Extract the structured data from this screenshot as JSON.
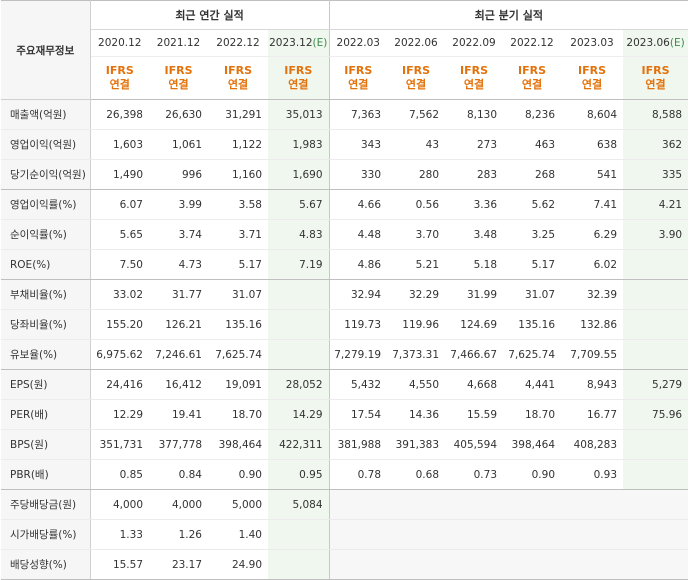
{
  "header": {
    "corner_label": "주요재무정보",
    "annual_title": "최근 연간 실적",
    "quarter_title": "최근 분기 실적",
    "ifrs_line1": "IFRS",
    "ifrs_line2": "연결"
  },
  "periods": [
    {
      "label": "2020.12",
      "estimate": ""
    },
    {
      "label": "2021.12",
      "estimate": ""
    },
    {
      "label": "2022.12",
      "estimate": ""
    },
    {
      "label": "2023.12",
      "estimate": "(E)"
    },
    {
      "label": "2022.03",
      "estimate": ""
    },
    {
      "label": "2022.06",
      "estimate": ""
    },
    {
      "label": "2022.09",
      "estimate": ""
    },
    {
      "label": "2022.12",
      "estimate": ""
    },
    {
      "label": "2023.03",
      "estimate": ""
    },
    {
      "label": "2023.06",
      "estimate": "(E)"
    }
  ],
  "rows": [
    {
      "label": "매출액(억원)",
      "values": [
        "26,398",
        "26,630",
        "31,291",
        "35,013",
        "7,363",
        "7,562",
        "8,130",
        "8,236",
        "8,604",
        "8,588"
      ]
    },
    {
      "label": "영업이익(억원)",
      "values": [
        "1,603",
        "1,061",
        "1,122",
        "1,983",
        "343",
        "43",
        "273",
        "463",
        "638",
        "362"
      ]
    },
    {
      "label": "당기순이익(억원)",
      "values": [
        "1,490",
        "996",
        "1,160",
        "1,690",
        "330",
        "280",
        "283",
        "268",
        "541",
        "335"
      ]
    },
    {
      "label": "영업이익률(%)",
      "values": [
        "6.07",
        "3.99",
        "3.58",
        "5.67",
        "4.66",
        "0.56",
        "3.36",
        "5.62",
        "7.41",
        "4.21"
      ]
    },
    {
      "label": "순이익률(%)",
      "values": [
        "5.65",
        "3.74",
        "3.71",
        "4.83",
        "4.48",
        "3.70",
        "3.48",
        "3.25",
        "6.29",
        "3.90"
      ]
    },
    {
      "label": "ROE(%)",
      "values": [
        "7.50",
        "4.73",
        "5.17",
        "7.19",
        "4.86",
        "5.21",
        "5.18",
        "5.17",
        "6.02",
        ""
      ]
    },
    {
      "label": "부채비율(%)",
      "values": [
        "33.02",
        "31.77",
        "31.07",
        "",
        "32.94",
        "32.29",
        "31.99",
        "31.07",
        "32.39",
        ""
      ]
    },
    {
      "label": "당좌비율(%)",
      "values": [
        "155.20",
        "126.21",
        "135.16",
        "",
        "119.73",
        "119.96",
        "124.69",
        "135.16",
        "132.86",
        ""
      ]
    },
    {
      "label": "유보율(%)",
      "values": [
        "6,975.62",
        "7,246.61",
        "7,625.74",
        "",
        "7,279.19",
        "7,373.31",
        "7,466.67",
        "7,625.74",
        "7,709.55",
        ""
      ]
    },
    {
      "label": "EPS(원)",
      "values": [
        "24,416",
        "16,412",
        "19,091",
        "28,052",
        "5,432",
        "4,550",
        "4,668",
        "4,441",
        "8,943",
        "5,279"
      ]
    },
    {
      "label": "PER(배)",
      "values": [
        "12.29",
        "19.41",
        "18.70",
        "14.29",
        "17.54",
        "14.36",
        "15.59",
        "18.70",
        "16.77",
        "75.96"
      ]
    },
    {
      "label": "BPS(원)",
      "values": [
        "351,731",
        "377,778",
        "398,464",
        "422,311",
        "381,988",
        "391,383",
        "405,594",
        "398,464",
        "408,283",
        ""
      ]
    },
    {
      "label": "PBR(배)",
      "values": [
        "0.85",
        "0.84",
        "0.90",
        "0.95",
        "0.78",
        "0.68",
        "0.73",
        "0.90",
        "0.93",
        ""
      ]
    },
    {
      "label": "주당배당금(원)",
      "values": [
        "4,000",
        "4,000",
        "5,000",
        "5,084",
        "",
        "",
        "",
        "",
        "",
        ""
      ]
    },
    {
      "label": "시가배당률(%)",
      "values": [
        "1.33",
        "1.26",
        "1.40",
        "",
        "",
        "",
        "",
        "",
        "",
        ""
      ]
    },
    {
      "label": "배당성향(%)",
      "values": [
        "15.57",
        "23.17",
        "24.90",
        "",
        "",
        "",
        "",
        "",
        "",
        ""
      ]
    }
  ]
}
